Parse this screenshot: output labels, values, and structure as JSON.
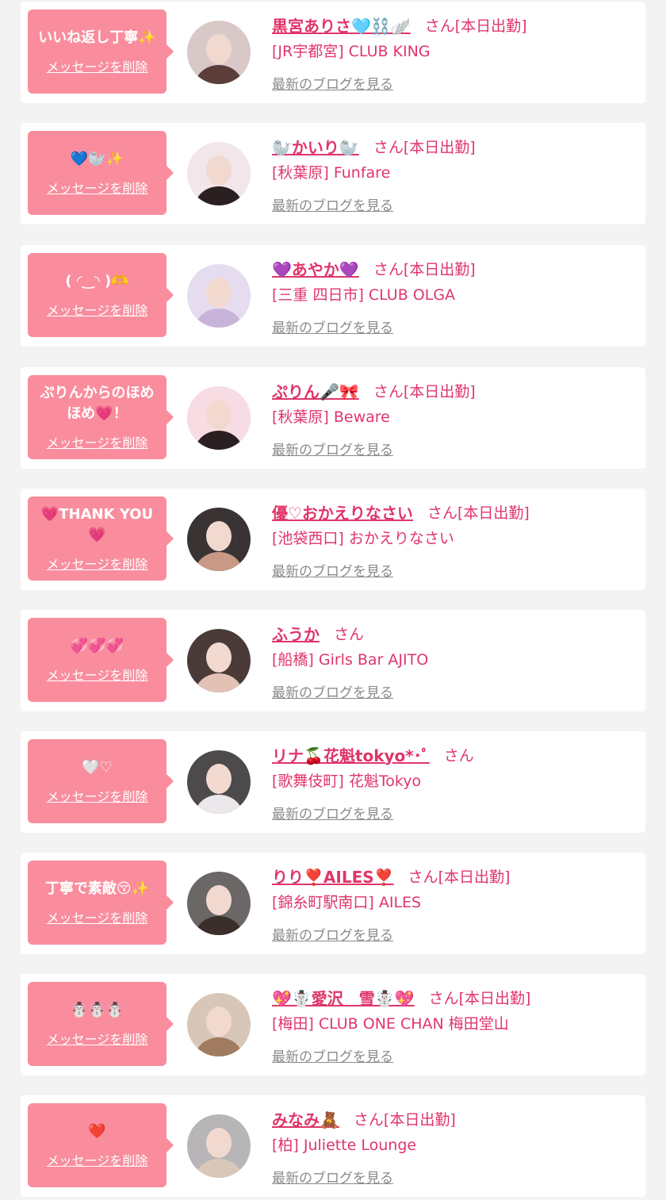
{
  "colors": {
    "accent": "#e0356a",
    "bubble": "#f98d9d",
    "link_gray": "#8a8a8a"
  },
  "labels": {
    "san": "さん",
    "delete": "メッセージを削除",
    "blog": "最新のブログを見る"
  },
  "cards": [
    {
      "message": "いいね返し丁寧✨",
      "name": "黒宮ありさ🩵⛓️🪽",
      "attendance": "[本日出勤]",
      "shop": "[JR宇都宮] CLUB KING",
      "avatar_colors": [
        "#d9c8c8",
        "#5b3d3a"
      ]
    },
    {
      "message": "💙🦭✨",
      "name": "🦭かいり🦭",
      "attendance": "[本日出勤]",
      "shop": "[秋葉原] Funfare",
      "avatar_colors": [
        "#f2e6ea",
        "#2a2022"
      ]
    },
    {
      "message": "( ◜‿◝ )🫶",
      "name": "💜あやか💜",
      "attendance": "[本日出勤]",
      "shop": "[三重 四日市] CLUB OLGA",
      "avatar_colors": [
        "#e6dcef",
        "#c9b4d9"
      ]
    },
    {
      "message": "ぷりんからのほめほめ💗！",
      "name": "ぷりん🎤🎀",
      "attendance": "[本日出勤]",
      "shop": "[秋葉原] Beware",
      "avatar_colors": [
        "#f8dce4",
        "#2a2022"
      ]
    },
    {
      "message": "💗THANK YOU💗",
      "name": "優♡おかえりなさい",
      "attendance": "[本日出勤]",
      "shop": "[池袋西口] おかえりなさい",
      "avatar_colors": [
        "#3a3333",
        "#c89a86"
      ]
    },
    {
      "message": "💞💞💞",
      "name": "ふうか",
      "attendance": "",
      "shop": "[船橋] Girls Bar AJITO",
      "avatar_colors": [
        "#4a3b38",
        "#e3c2b5"
      ]
    },
    {
      "message": "🤍♡",
      "name": "リナ🍒花魁tokyo*･ﾟ",
      "attendance": "",
      "shop": "[歌舞伎町] 花魁Tokyo",
      "avatar_colors": [
        "#4c4a4b",
        "#ece7ea"
      ]
    },
    {
      "message": "丁寧で素敵😚✨",
      "name": "りり❣️AILES❣️",
      "attendance": "[本日出勤]",
      "shop": "[錦糸町駅南口] AILES",
      "avatar_colors": [
        "#6b6766",
        "#3b2f2c"
      ]
    },
    {
      "message": "☃️☃️☃️",
      "name": "💖☃️愛沢＿雪☃️💖",
      "attendance": "[本日出勤]",
      "shop": "[梅田] CLUB ONE CHAN 梅田堂山",
      "avatar_colors": [
        "#d8c7b8",
        "#a07b5f"
      ]
    },
    {
      "message": "❤️",
      "name": "みなみ🧸",
      "attendance": "[本日出勤]",
      "shop": "[柏] Juliette Lounge",
      "avatar_colors": [
        "#b7b5b8",
        "#d9c7b8"
      ]
    }
  ]
}
